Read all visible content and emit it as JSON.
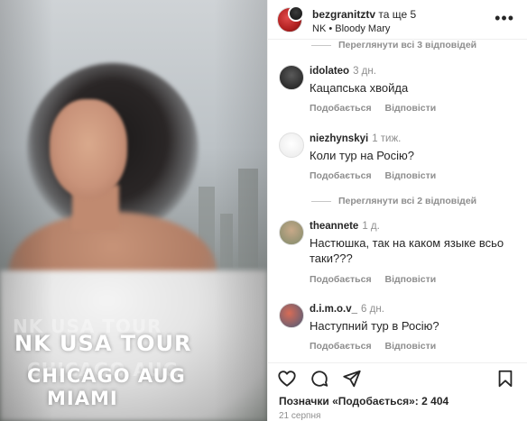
{
  "media": {
    "overlay_line1": "NK USA TOUR",
    "overlay_line2": "CHICAGO AUG",
    "overlay_line3": "MIAMI"
  },
  "header": {
    "username": "bezgranitztv",
    "coauthors": "та ще 5",
    "subtitle": "NK • Bloody Mary",
    "more_icon": "more-horizontal-icon"
  },
  "comments": [
    {
      "kind": "replies",
      "label": "Переглянути всі 3 відповідей"
    },
    {
      "kind": "comment",
      "user": "idolateo",
      "time": "3 дн.",
      "text": "Кацапська хвойда",
      "like": "Подобається",
      "reply": "Відповісти",
      "avatar_color": "#2b2b2b"
    },
    {
      "kind": "comment",
      "user": "niezhynskyi",
      "time": "1 тиж.",
      "text": "Коли тур на Росію?",
      "like": "Подобається",
      "reply": "Відповісти",
      "avatar_color": "#f2f2f2"
    },
    {
      "kind": "replies",
      "label": "Переглянути всі 2 відповідей"
    },
    {
      "kind": "comment",
      "user": "theannete",
      "time": "1 д.",
      "text": "Настюшка, так на каком языке всьо таки???",
      "like": "Подобається",
      "reply": "Відповісти",
      "avatar_color": "#9aa48c"
    },
    {
      "kind": "comment",
      "user": "d.i.m.o.v_",
      "time": "6 дн.",
      "text": "Наступний тур в Росію?",
      "like": "Подобається",
      "reply": "Відповісти",
      "avatar_color": "#b4503f"
    }
  ],
  "footer": {
    "likes_text": "Позначки «Подобається»: 2 404",
    "date": "21 серпня"
  },
  "colors": {
    "text": "#262626",
    "secondary": "#8e8e8e",
    "divider": "#efefef"
  }
}
